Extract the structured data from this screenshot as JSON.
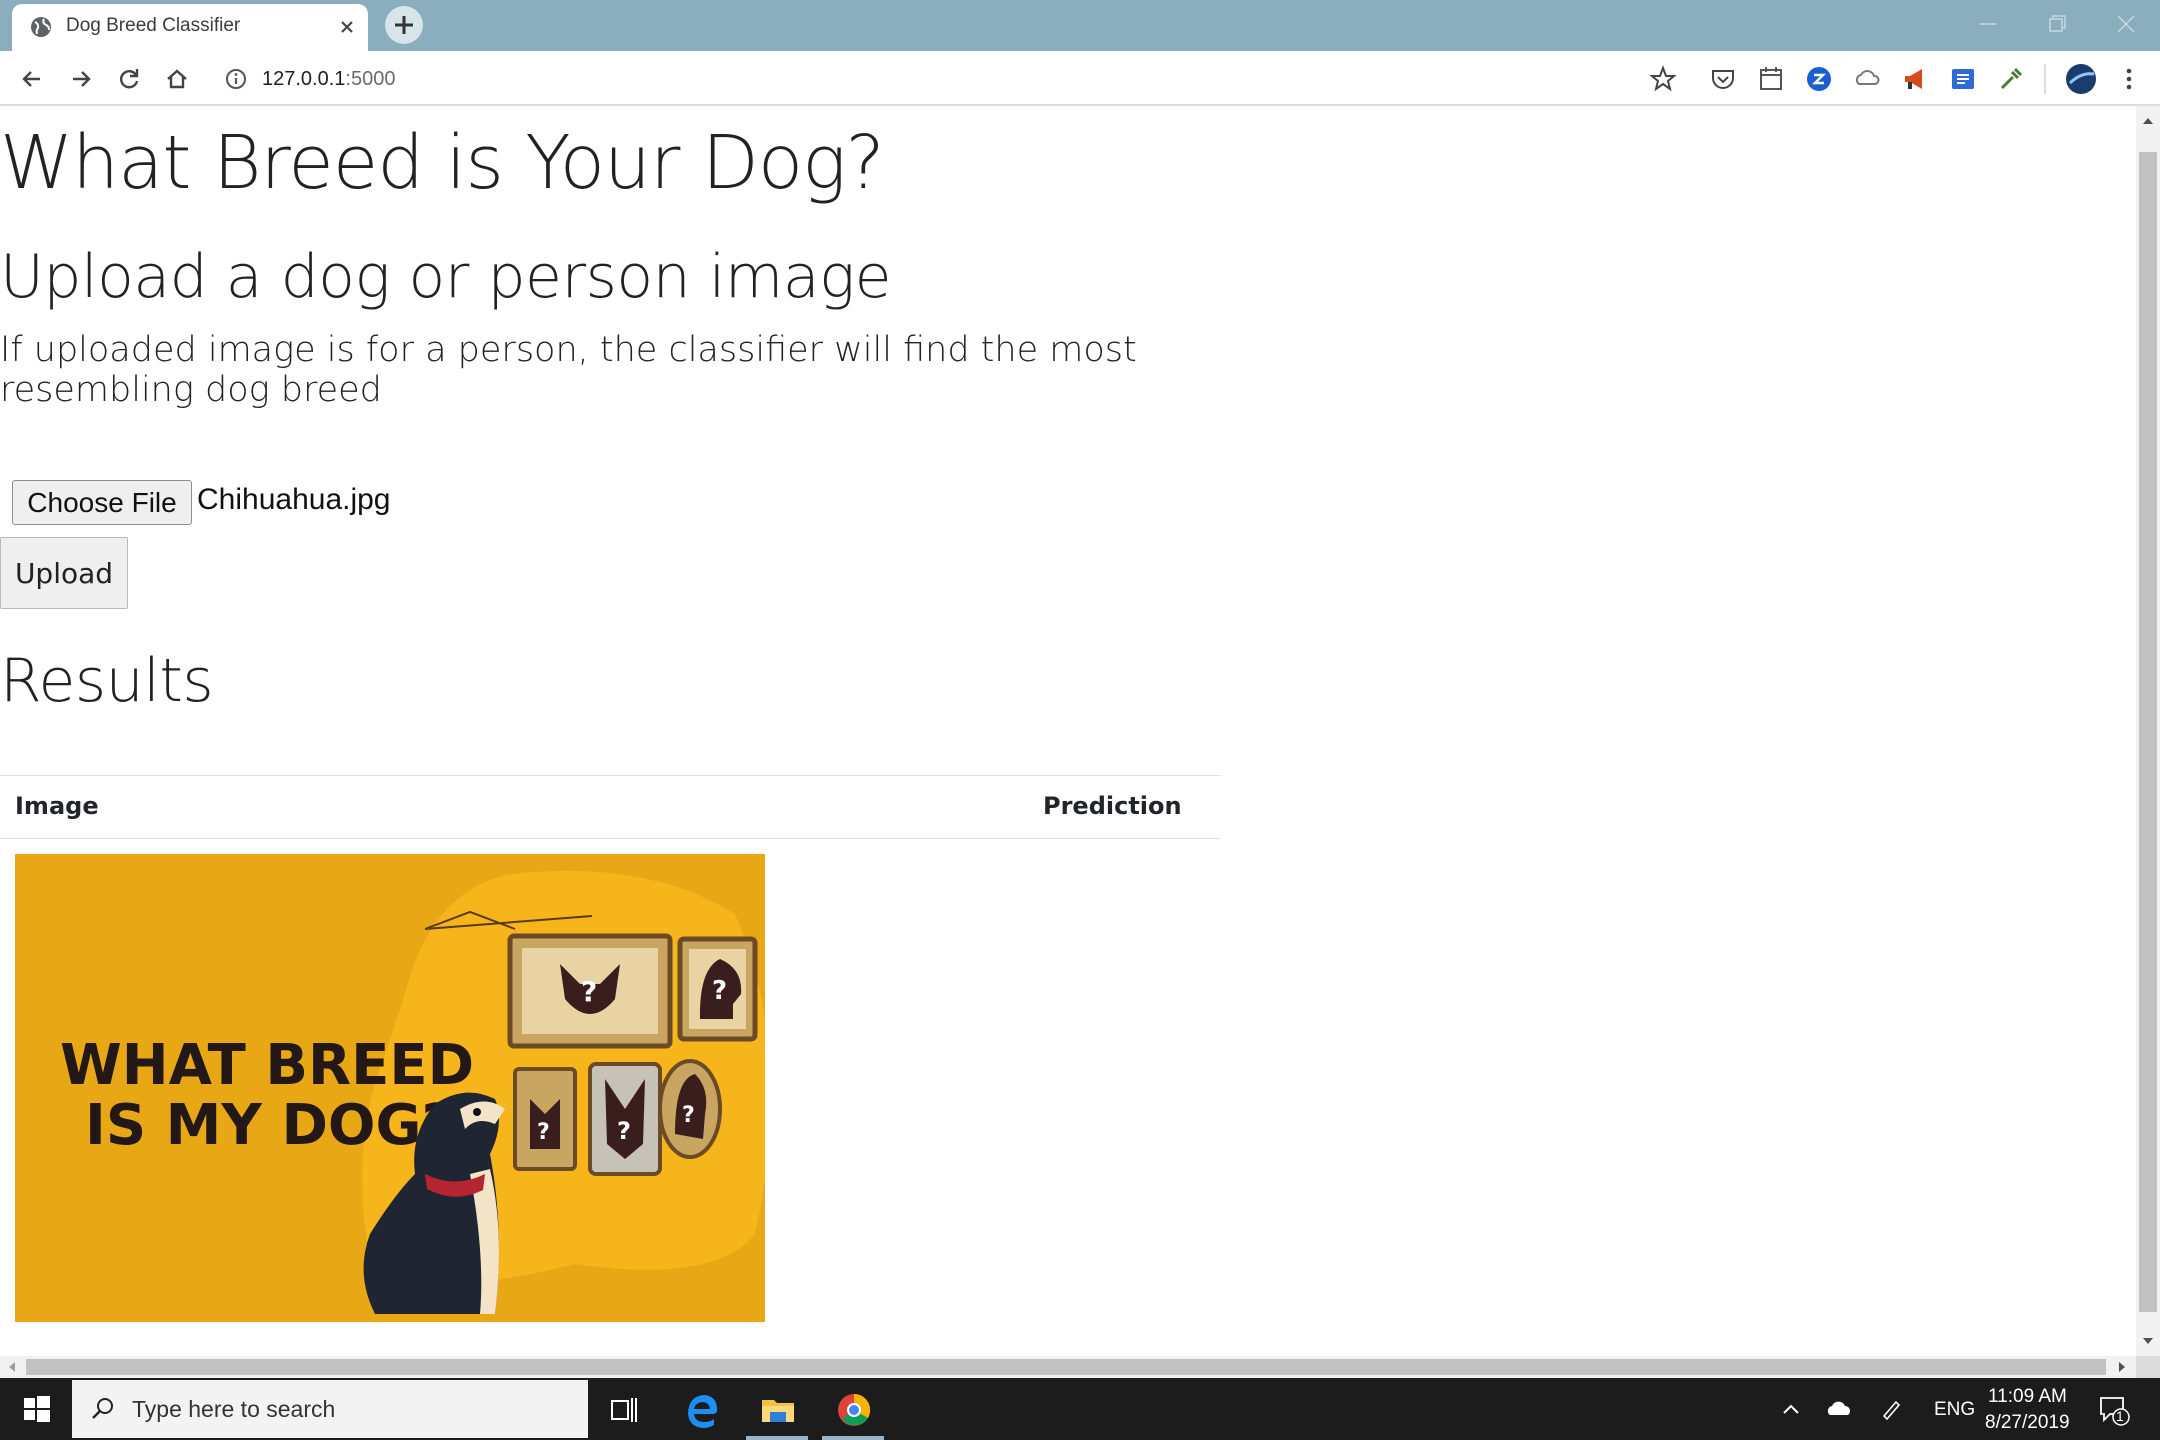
{
  "browser": {
    "tab_title": "Dog Breed Classifier",
    "url_host": "127.0.0.1",
    "url_port": ":5000"
  },
  "page": {
    "heading": "What Breed is Your Dog?",
    "subheading": "Upload a dog or person image",
    "description": "If uploaded image is for a person, the classifier will find the most resembling dog breed",
    "choose_file_label": "Choose File",
    "chosen_file": "Chihuahua.jpg",
    "upload_label": "Upload",
    "results_heading": "Results",
    "table": {
      "col_image": "Image",
      "col_prediction": "Prediction"
    },
    "result_image": {
      "text_line1": "WHAT BREED",
      "text_line2": "IS MY DOG?",
      "background": "#e8a816"
    }
  },
  "taskbar": {
    "search_placeholder": "Type here to search",
    "language": "ENG",
    "time": "11:09 AM",
    "date": "8/27/2019",
    "notification_count": "1"
  },
  "colors": {
    "tabstrip": "#8aaebd",
    "taskbar": "#1c1c1c"
  }
}
